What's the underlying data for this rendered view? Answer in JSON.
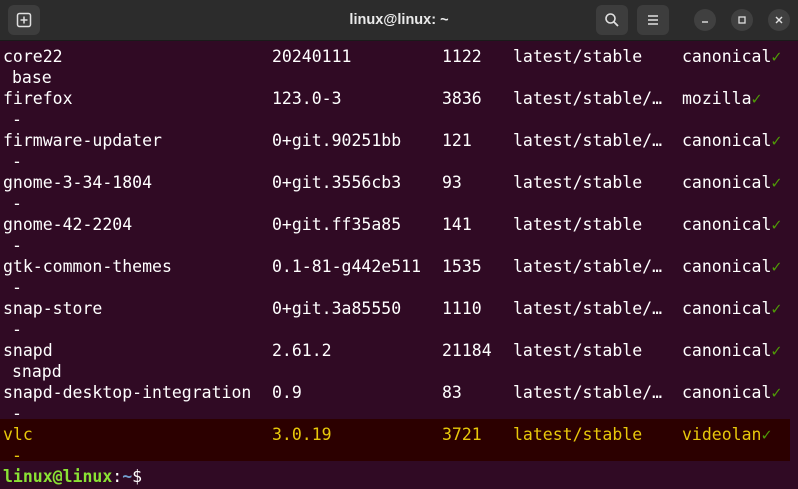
{
  "window": {
    "title": "linux@linux: ~",
    "icons": {
      "new_tab": "new-tab-icon",
      "search": "search-icon",
      "menu": "hamburger-menu-icon",
      "minimize": "minimize-icon",
      "maximize": "maximize-icon",
      "close": "close-icon"
    }
  },
  "colors": {
    "background": "#300a24",
    "highlight_text": "#e8c80a",
    "check": "#4e9a06",
    "prompt_user": "#8ae234",
    "prompt_path": "#729fcf"
  },
  "rows": [
    {
      "name": "core22",
      "version": "20240111",
      "rev": "1122",
      "tracking": "latest/stable",
      "publisher": "canonical",
      "check": "✓",
      "notes": "base",
      "highlighted": false
    },
    {
      "name": "firefox",
      "version": "123.0-3",
      "rev": "3836",
      "tracking": "latest/stable/…",
      "publisher": "mozilla",
      "check": "✓",
      "notes": "-",
      "highlighted": false
    },
    {
      "name": "firmware-updater",
      "version": "0+git.90251bb",
      "rev": "121",
      "tracking": "latest/stable/…",
      "publisher": "canonical",
      "check": "✓",
      "notes": "-",
      "highlighted": false
    },
    {
      "name": "gnome-3-34-1804",
      "version": "0+git.3556cb3",
      "rev": "93",
      "tracking": "latest/stable",
      "publisher": "canonical",
      "check": "✓",
      "notes": "-",
      "highlighted": false
    },
    {
      "name": "gnome-42-2204",
      "version": "0+git.ff35a85",
      "rev": "141",
      "tracking": "latest/stable",
      "publisher": "canonical",
      "check": "✓",
      "notes": "-",
      "highlighted": false
    },
    {
      "name": "gtk-common-themes",
      "version": "0.1-81-g442e511",
      "rev": "1535",
      "tracking": "latest/stable/…",
      "publisher": "canonical",
      "check": "✓",
      "notes": "-",
      "highlighted": false
    },
    {
      "name": "snap-store",
      "version": "0+git.3a85550",
      "rev": "1110",
      "tracking": "latest/stable/…",
      "publisher": "canonical",
      "check": "✓",
      "notes": "-",
      "highlighted": false
    },
    {
      "name": "snapd",
      "version": "2.61.2",
      "rev": "21184",
      "tracking": "latest/stable",
      "publisher": "canonical",
      "check": "✓",
      "notes": "snapd",
      "highlighted": false
    },
    {
      "name": "snapd-desktop-integration",
      "version": "0.9",
      "rev": "83",
      "tracking": "latest/stable/…",
      "publisher": "canonical",
      "check": "✓",
      "notes": "-",
      "highlighted": false
    },
    {
      "name": "vlc",
      "version": "3.0.19",
      "rev": "3721",
      "tracking": "latest/stable",
      "publisher": "videolan",
      "check": "✓",
      "notes": "-",
      "highlighted": true
    }
  ],
  "prompt": {
    "user_host": "linux@linux",
    "separator": ":",
    "path": "~",
    "symbol": "$"
  }
}
